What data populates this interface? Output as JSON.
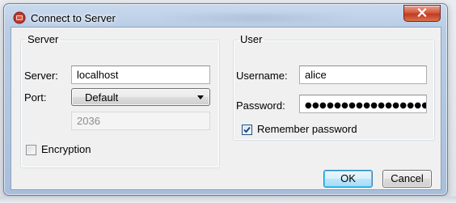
{
  "window": {
    "title": "Connect to Server",
    "close_label": "x"
  },
  "server": {
    "group_label": "Server",
    "server_label": "Server:",
    "server_value": "localhost",
    "port_label": "Port:",
    "port_selected": "Default",
    "port_number": "2036",
    "encryption_label": "Encryption",
    "encryption_checked": false
  },
  "user": {
    "group_label": "User",
    "username_label": "Username:",
    "username_value": "alice",
    "password_label": "Password:",
    "password_masked": "●●●●●●●●●●●●●●●●●●",
    "remember_label": "Remember password",
    "remember_checked": true
  },
  "buttons": {
    "ok_label": "OK",
    "cancel_label": "Cancel"
  },
  "icons": {
    "app_icon": "app-icon",
    "close_icon": "close-icon",
    "dropdown_icon": "chevron-down-icon",
    "check_icon": "checkmark-icon"
  },
  "colors": {
    "close_button": "#c8432a",
    "default_button_border": "#3c7fb1",
    "title_bar": "#b9cde6"
  }
}
